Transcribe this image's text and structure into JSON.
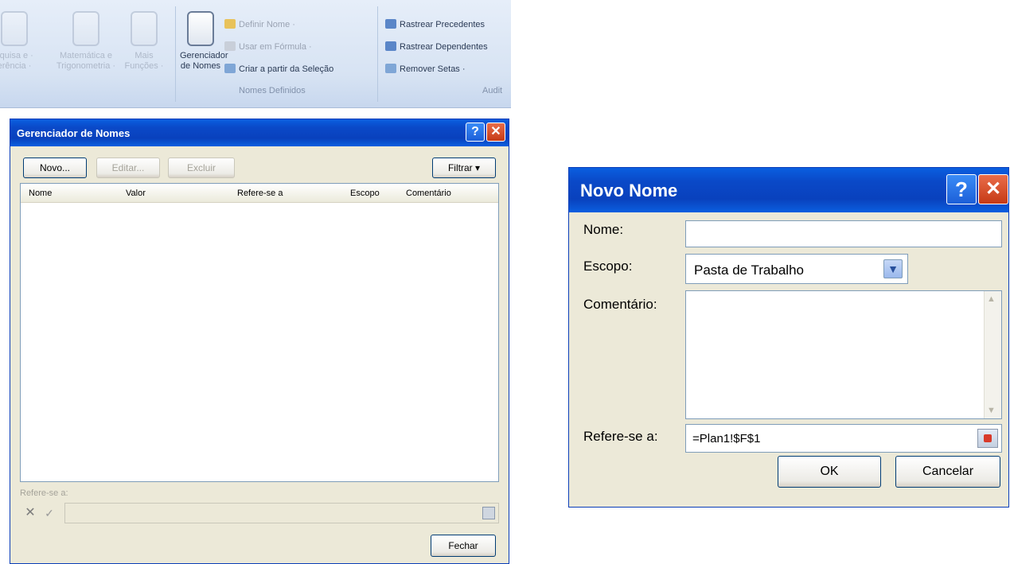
{
  "ribbon": {
    "group1_label_a": "squisa e",
    "group1_label_b": "erência",
    "math_label_a": "Matemática e",
    "math_label_b": "Trigonometria",
    "more_label_a": "Mais",
    "more_label_b": "Funções",
    "name_manager_a": "Gerenciador",
    "name_manager_b": "de Nomes",
    "define_name": "Definir Nome",
    "use_in_formula": "Usar em Fórmula",
    "create_from_selection": "Criar a partir da Seleção",
    "defined_names_group": "Nomes Definidos",
    "trace_precedents": "Rastrear Precedentes",
    "trace_dependents": "Rastrear Dependentes",
    "remove_arrows": "Remover Setas",
    "auditing_group": "Audit"
  },
  "name_manager": {
    "title": "Gerenciador de Nomes",
    "new_button": "Novo...",
    "edit_button": "Editar...",
    "delete_button": "Excluir",
    "filter_button": "Filtrar",
    "columns": [
      "Nome",
      "Valor",
      "Refere-se a",
      "Escopo",
      "Comentário"
    ],
    "refers_to_label": "Refere-se a:",
    "close_button": "Fechar"
  },
  "new_name": {
    "title": "Novo Nome",
    "name_label": "Nome:",
    "name_value": "",
    "scope_label": "Escopo:",
    "scope_value": "Pasta de Trabalho",
    "comment_label": "Comentário:",
    "comment_value": "",
    "refers_to_label": "Refere-se a:",
    "refers_to_value": "=Plan1!$F$1",
    "ok_button": "OK",
    "cancel_button": "Cancelar"
  },
  "colors": {
    "titlebar": "#0a49c8",
    "dialog_face": "#ece9d8",
    "close_red": "#d8481f"
  }
}
